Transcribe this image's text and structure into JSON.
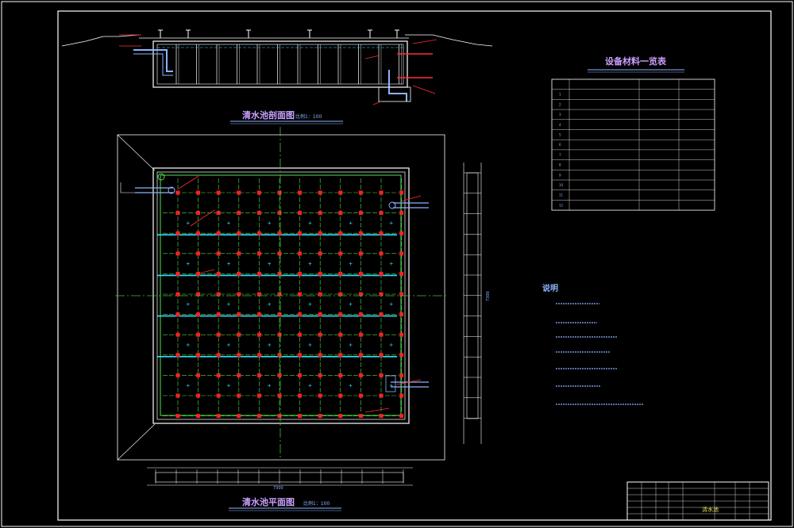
{
  "titles": {
    "section": "清水池剖面图",
    "section_scale": "比例1：100",
    "plan": "清水池平面图",
    "plan_scale": "比例1：100",
    "table": "设备材料一览表",
    "notes": "说明"
  },
  "dimensions": {
    "plan_width": "7300",
    "plan_height": "7300"
  },
  "table_rows": [
    "1",
    "2",
    "3",
    "4",
    "5",
    "6",
    "7",
    "8",
    "9",
    "10",
    "11",
    "12"
  ],
  "title_block": {
    "drawing_name": "清水池"
  },
  "colors": {
    "background": "#000000",
    "frame": "#ffffff",
    "text": "#8cb4ff",
    "wall": "#ffffff",
    "grid": "#4fe04f",
    "axis": "#40c040",
    "column": "#ff2020",
    "pipe": "#30e0ff",
    "annotation": "#ff3030",
    "title": "#c8a0ff"
  }
}
